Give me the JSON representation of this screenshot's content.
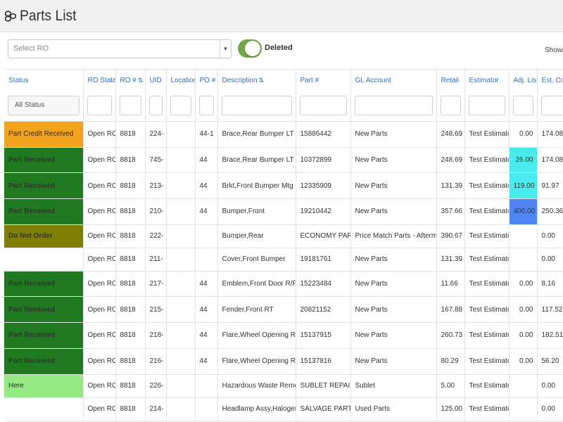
{
  "header": {
    "title": "Parts List",
    "icon": "cubes-icon"
  },
  "toolbar": {
    "ro_select_placeholder": "Select RO",
    "toggle_label": "Deleted",
    "toggle_on": true,
    "toggle_color": "#72a646",
    "showing_text": "Showin"
  },
  "table": {
    "columns": [
      "Status",
      "RO State",
      "RO #",
      "UID",
      "Location",
      "PO #",
      "Description",
      "Part #",
      "GL Account",
      "Retail",
      "Estimator",
      "Adj. List",
      "Est. Cos"
    ],
    "sortable_columns": [
      "RO #",
      "Description"
    ],
    "status_filter": "All Status",
    "rows": [
      {
        "status": "Part Credit Received",
        "status_color": "#f2a21b",
        "ro_state": "Open RO",
        "ro": "8818",
        "uid": "224-",
        "location": "",
        "po": "44-1",
        "description": "Brace,Rear Bumper LT",
        "part": "15886442",
        "gl": "New Parts",
        "retail": "248.69",
        "estimator": "Test Estimator",
        "adj": "0.00",
        "adj_color": "",
        "est_cost": "174.08"
      },
      {
        "status": "Part Received",
        "status_color": "#1f7a1f",
        "ro_state": "Open RO",
        "ro": "8818",
        "uid": "745-",
        "location": "",
        "po": "44",
        "description": "Brace,Rear Bumper LT",
        "part": "10372899",
        "gl": "New Parts",
        "retail": "248.69",
        "estimator": "Test Estimator",
        "adj": "26.00",
        "adj_color": "#49ecec",
        "est_cost": "174.08"
      },
      {
        "status": "Part Received",
        "status_color": "#1f7a1f",
        "ro_state": "Open RO",
        "ro": "8818",
        "uid": "213-",
        "location": "",
        "po": "44",
        "description": "Brkt,Front Bumper Mtg RT",
        "part": "12335909",
        "gl": "New Parts",
        "retail": "131.39",
        "estimator": "Test Estimator",
        "adj": "119.00",
        "adj_color": "#49ecec",
        "est_cost": "91.97"
      },
      {
        "status": "Part Received",
        "status_color": "#1f7a1f",
        "ro_state": "Open RO",
        "ro": "8818",
        "uid": "210-",
        "location": "",
        "po": "44",
        "description": "Bumper,Front",
        "part": "19210442",
        "gl": "New Parts",
        "retail": "357.66",
        "estimator": "Test Estimator",
        "adj": "400.00",
        "adj_color": "#4f86f4",
        "est_cost": "250.36"
      },
      {
        "status": "Do Not Order",
        "status_color": "#7f7f06",
        "ro_state": "Open RO",
        "ro": "8818",
        "uid": "222-",
        "location": "",
        "po": "",
        "description": "Bumper,Rear",
        "part": "ECONOMY PART",
        "gl": "Price Match Parts - Aftermarket",
        "retail": "390.67",
        "estimator": "Test Estimator",
        "adj": "",
        "adj_color": "",
        "est_cost": "0.00"
      },
      {
        "status": "",
        "status_color": "",
        "ro_state": "Open RO",
        "ro": "8818",
        "uid": "211-",
        "location": "",
        "po": "",
        "description": "Cover,Front Bumper",
        "part": "19181761",
        "gl": "New Parts",
        "retail": "131.39",
        "estimator": "Test Estimator",
        "adj": "",
        "adj_color": "",
        "est_cost": "0.00"
      },
      {
        "status": "Part Received",
        "status_color": "#1f7a1f",
        "ro_state": "Open RO",
        "ro": "8818",
        "uid": "217-",
        "location": "",
        "po": "44",
        "description": "Emblem,Front Door R/F",
        "part": "15223484",
        "gl": "New Parts",
        "retail": "11.66",
        "estimator": "Test Estimator",
        "adj": "0.00",
        "adj_color": "",
        "est_cost": "8.16"
      },
      {
        "status": "Part Received",
        "status_color": "#1f7a1f",
        "ro_state": "Open RO",
        "ro": "8818",
        "uid": "215-",
        "location": "",
        "po": "44",
        "description": "Fender,Front RT",
        "part": "20821152",
        "gl": "New Parts",
        "retail": "167.88",
        "estimator": "Test Estimator",
        "adj": "0.00",
        "adj_color": "",
        "est_cost": "117.52"
      },
      {
        "status": "Part Received",
        "status_color": "#1f7a1f",
        "ro_state": "Open RO",
        "ro": "8818",
        "uid": "218-",
        "location": "",
        "po": "44",
        "description": "Flare,Wheel Opening RT",
        "part": "15137915",
        "gl": "New Parts",
        "retail": "260.73",
        "estimator": "Test Estimator",
        "adj": "0.00",
        "adj_color": "",
        "est_cost": "182.51"
      },
      {
        "status": "Part Received",
        "status_color": "#1f7a1f",
        "ro_state": "Open RO",
        "ro": "8818",
        "uid": "216-",
        "location": "",
        "po": "44",
        "description": "Flare,Wheel Opening RT",
        "part": "15137816",
        "gl": "New Parts",
        "retail": "80.29",
        "estimator": "Test Estimator",
        "adj": "0.00",
        "adj_color": "",
        "est_cost": "56.20"
      },
      {
        "status": "Here",
        "status_color": "#95ea83",
        "ro_state": "Open RO",
        "ro": "8818",
        "uid": "226-",
        "location": "",
        "po": "",
        "description": "Hazardous Waste Remove",
        "part": "SUBLET REPAIR",
        "gl": "Sublet",
        "retail": "5.00",
        "estimator": "Test Estimator",
        "adj": "",
        "adj_color": "",
        "est_cost": "0.00"
      },
      {
        "status": "",
        "status_color": "",
        "ro_state": "Open RO",
        "ro": "8818",
        "uid": "214-",
        "location": "",
        "po": "",
        "description": "Headlamp Assy,Halogen RT",
        "part": "SALVAGE PART",
        "gl": "Used Parts",
        "retail": "125.00",
        "estimator": "Test Estimator",
        "adj": "",
        "adj_color": "",
        "est_cost": "0.00"
      }
    ]
  }
}
